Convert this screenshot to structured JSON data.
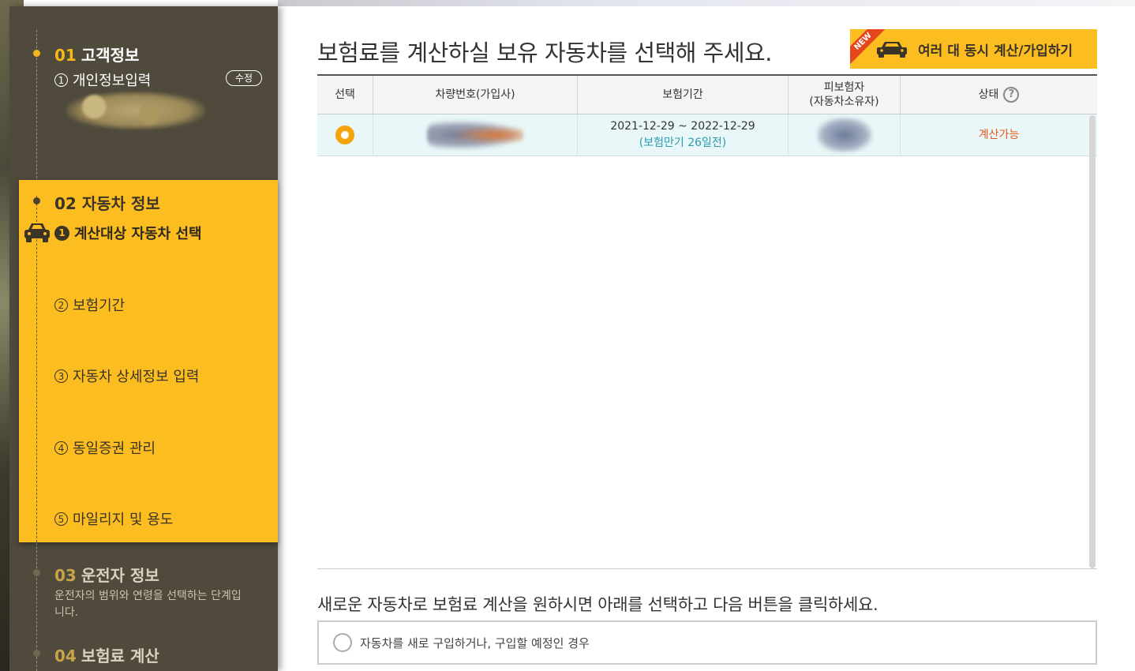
{
  "sidebar": {
    "sections": [
      {
        "num": "01",
        "title": "고객정보",
        "sub": {
          "index": "1",
          "label": "개인정보입력",
          "edit_label": "수정"
        }
      },
      {
        "num": "02",
        "title": "자동차 정보",
        "active_item": {
          "index": "1",
          "label": "계산대상 자동차 선택"
        },
        "items": [
          {
            "index": "2",
            "label": "보험기간"
          },
          {
            "index": "3",
            "label": "자동차 상세정보 입력"
          },
          {
            "index": "4",
            "label": "동일증권 관리"
          },
          {
            "index": "5",
            "label": "마일리지 및 용도"
          }
        ]
      },
      {
        "num": "03",
        "title": "운전자 정보",
        "desc": "운전자의 범위와 연령을 선택하는 단계입니다."
      },
      {
        "num": "04",
        "title": "보험료 계산"
      }
    ]
  },
  "main": {
    "heading": "보험료를 계산하실 보유 자동차를 선택해 주세요.",
    "multi_button": {
      "badge": "NEW",
      "label": "여러 대 동시 계산/가입하기"
    },
    "table": {
      "headers": {
        "select": "선택",
        "plate": "차량번호(가입사)",
        "period": "보험기간",
        "insured_line1": "피보험자",
        "insured_line2": "(자동차소유자)",
        "status": "상태"
      },
      "rows": [
        {
          "period": "2021-12-29 ~ 2022-12-29",
          "period_note": "(보험만기 26일전)",
          "status": "계산가능"
        }
      ]
    },
    "new_car_note": "새로운 자동차로 보험료 계산을 원하시면 아래를 선택하고 다음 버튼을 클릭하세요.",
    "new_car_option": "자동차를 새로 구입하거나, 구입할 예정인 경우"
  },
  "colors": {
    "accent": "#fcbd21",
    "sidebar_bg": "#4f4a3c",
    "status": "#e65a1a",
    "note": "#2a9bb0"
  }
}
